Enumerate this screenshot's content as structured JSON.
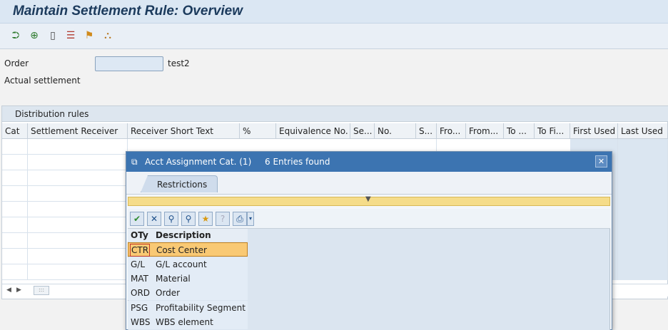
{
  "header": {
    "title": "Maintain Settlement Rule: Overview"
  },
  "toolbar": {
    "icons": [
      "expand-icon",
      "search-icon",
      "new-document-icon",
      "delete-row-icon",
      "hierarchy-icon",
      "structure-icon"
    ]
  },
  "form": {
    "order_label": "Order",
    "order_value": "",
    "order_text": "test2",
    "actual_settlement_label": "Actual settlement"
  },
  "distribution": {
    "group_title": "Distribution rules",
    "columns": [
      "Cat",
      "Settlement Receiver",
      "Receiver Short Text",
      "%",
      "Equivalence No.",
      "Se...",
      "No.",
      "S...",
      "Fro...",
      "From...",
      "To ...",
      "To Fi...",
      "First Used",
      "Last Used"
    ]
  },
  "dialog": {
    "title": "Acct Assignment Cat. (1)",
    "entries_found": "6 Entries found",
    "tab_label": "Restrictions",
    "list_headers": {
      "code": "OTy",
      "description": "Description"
    },
    "entries": [
      {
        "code": "CTR",
        "description": "Cost Center"
      },
      {
        "code": "G/L",
        "description": "G/L account"
      },
      {
        "code": "MAT",
        "description": "Material"
      },
      {
        "code": "ORD",
        "description": "Order"
      },
      {
        "code": "PSG",
        "description": "Profitability Segment"
      },
      {
        "code": "WBS",
        "description": "WBS element"
      }
    ],
    "close_glyph": "✕"
  },
  "colors": {
    "title_bg": "#dbe7f3",
    "dialog_title_bg": "#3c74b1",
    "selected_row": "#f9c974",
    "restriction_bar": "#f5dc8a"
  }
}
